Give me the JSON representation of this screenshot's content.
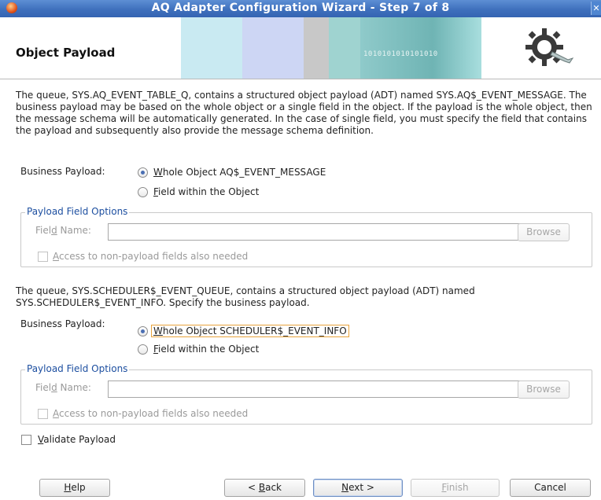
{
  "window": {
    "title": "AQ Adapter Configuration Wizard - Step 7 of 8",
    "close_glyph": "✕"
  },
  "header": {
    "page_title": "Object Payload",
    "ticker_text": "1010101010101010",
    "band_colors": [
      "#c9eaf2",
      "#cdd6f4",
      "#c8c8c8",
      "#9fd3d0",
      "#6fb4b4"
    ]
  },
  "section1": {
    "description": "The queue, SYS.AQ_EVENT_TABLE_Q, contains a structured object payload (ADT) named SYS.AQ$_EVENT_MESSAGE.  The business payload may be based on the whole object or a single field in the object. If the payload is the whole object, then the message schema will be automatically generated. In the case of single field, you must specify the field that contains the payload and subsequently also provide the message schema definition.",
    "business_payload_label": "Business Payload:",
    "whole_object": {
      "prefix": "W",
      "rest": "hole Object AQ$_EVENT_MESSAGE",
      "selected": true
    },
    "field_within": {
      "prefix": "F",
      "rest": "ield within the Object",
      "selected": false
    },
    "options": {
      "legend": "Payload Field Options",
      "field_name_a": "Fiel",
      "field_name_u": "d",
      "field_name_b": " Name:",
      "field_value": "",
      "browse": "Browse",
      "access_u": "A",
      "access_rest": "ccess to non-payload fields also needed",
      "access_checked": false
    }
  },
  "section2": {
    "description": "The queue, SYS.SCHEDULER$_EVENT_QUEUE, contains a structured object payload (ADT) named SYS.SCHEDULER$_EVENT_INFO.  Specify the business payload.",
    "business_payload_label": "Business Payload:",
    "whole_object": {
      "prefix": "W",
      "rest": "hole Object SCHEDULER$_EVENT_INFO",
      "selected": true
    },
    "field_within": {
      "prefix": "F",
      "rest": "ield within the Object",
      "selected": false
    },
    "options": {
      "legend": "Payload Field Options",
      "field_name_a": "Fiel",
      "field_name_u": "d",
      "field_name_b": " Name:",
      "field_value": "",
      "browse": "Browse",
      "access_u": "A",
      "access_rest": "ccess to non-payload fields also needed",
      "access_checked": false
    }
  },
  "validate": {
    "u": "V",
    "rest": "alidate Payload",
    "checked": false
  },
  "footer": {
    "help": {
      "u": "H",
      "rest": "elp"
    },
    "back": {
      "pre": "< ",
      "u": "B",
      "rest": "ack"
    },
    "next": {
      "u": "N",
      "rest": "ext >"
    },
    "finish": {
      "u": "F",
      "rest": "inish"
    },
    "cancel": "Cancel"
  }
}
